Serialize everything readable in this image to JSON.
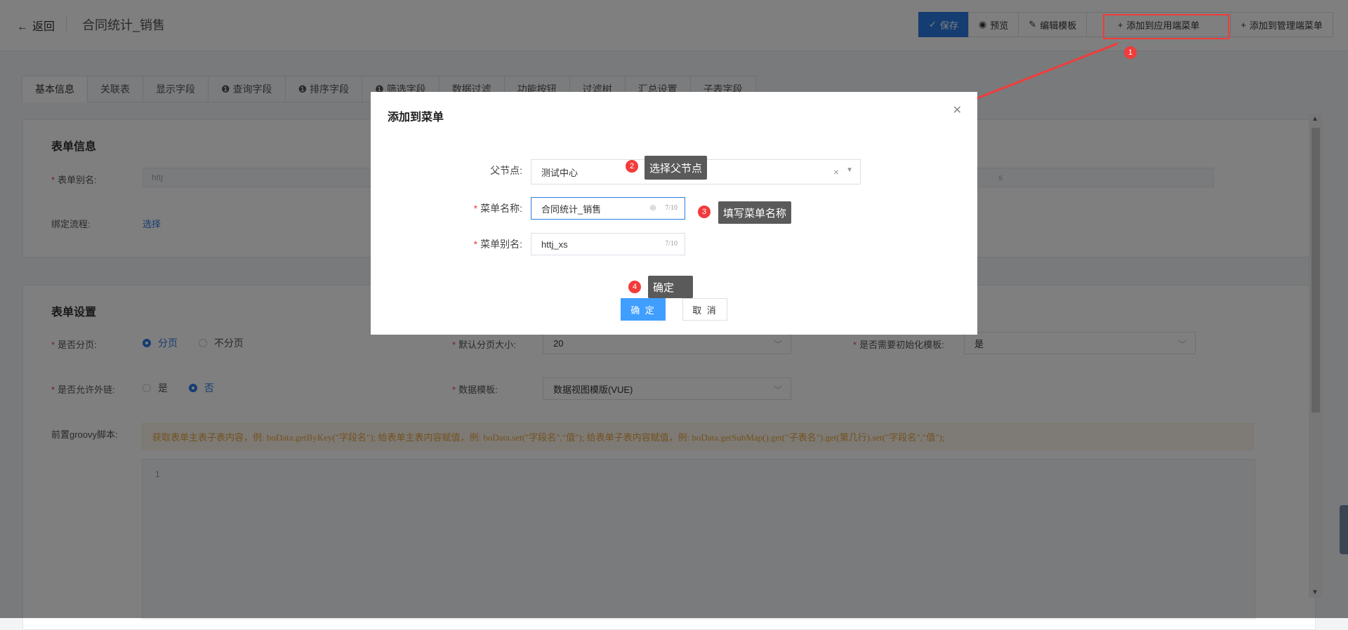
{
  "header": {
    "back_label": "返回",
    "title": "合同统计_销售",
    "toolbar": {
      "save": "保存",
      "preview": "预览",
      "edit_template": "编辑模板",
      "add_app_menu": "添加到应用端菜单",
      "add_admin_menu": "添加到管理端菜单"
    }
  },
  "tabs": [
    "基本信息",
    "关联表",
    "显示字段",
    "查询字段",
    "排序字段",
    "筛选字段",
    "数据过滤",
    "功能按钮",
    "过滤树",
    "汇总设置",
    "子表字段"
  ],
  "form_info": {
    "title": "表单信息",
    "alias_label": "表单别名:",
    "alias_value": "httj",
    "right_partial_value": "s",
    "flow_label": "绑定流程:",
    "flow_link": "选择"
  },
  "form_settings": {
    "title": "表单设置",
    "paging_label": "是否分页:",
    "paging_options": [
      "分页",
      "不分页"
    ],
    "page_size_label": "默认分页大小:",
    "page_size_value": "20",
    "init_template_label": "是否需要初始化模板:",
    "init_template_value": "是",
    "external_label": "是否允许外链:",
    "external_options": [
      "是",
      "否"
    ],
    "data_template_label": "数据模板:",
    "data_template_value": "数据视图模版(VUE)",
    "groovy_label": "前置groovy脚本:",
    "groovy_hint": "获取表单主表子表内容，例: boData.getByKey(\"字段名\"); 给表单主表内容赋值，例: boData.set(\"字段名\",\"值\"); 给表单子表内容赋值，例: boData.getSubMap().get(\"子表名\").get(第几行).set(\"字段名\",\"值\");",
    "editor_line": "1"
  },
  "dialog": {
    "title": "添加到菜单",
    "parent_label": "父节点:",
    "parent_value": "测试中心",
    "menu_name_label": "菜单名称:",
    "menu_name_value": "合同统计_销售",
    "menu_name_count": "7/10",
    "menu_alias_label": "菜单别名:",
    "menu_alias_value": "httj_xs",
    "menu_alias_count": "7/10",
    "ok_label": "确 定",
    "cancel_label": "取 消"
  },
  "annotations": [
    {
      "number": "1",
      "text": ""
    },
    {
      "number": "2",
      "text": "选择父节点"
    },
    {
      "number": "3",
      "text": "填写菜单名称"
    },
    {
      "number": "4",
      "text": "确定"
    }
  ],
  "colors": {
    "primary": "#2c7be5",
    "ok_button": "#409eff",
    "annotation_red": "#f23b3b",
    "warning_text": "#e6a23c"
  }
}
